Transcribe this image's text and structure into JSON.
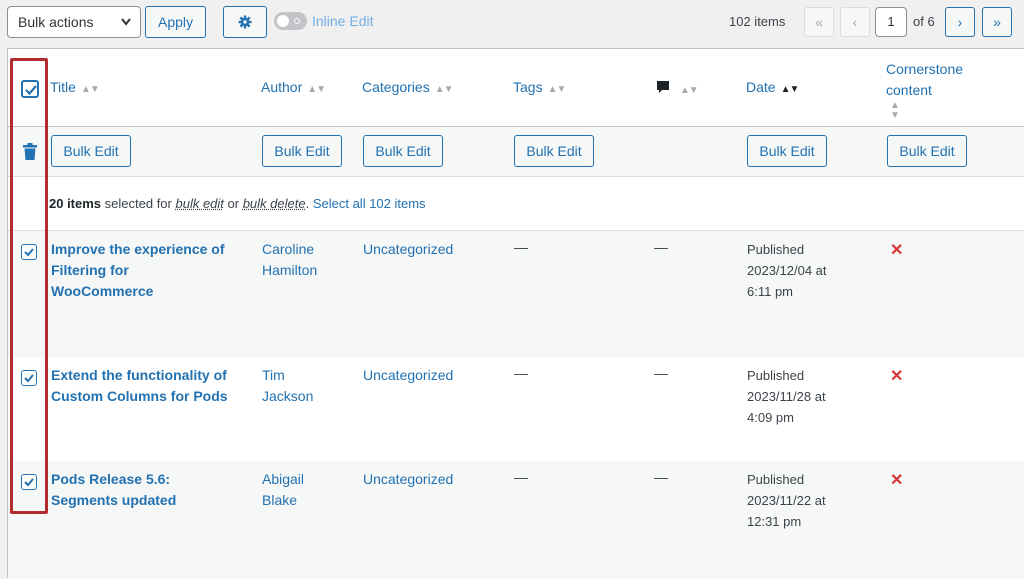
{
  "toolbar": {
    "bulk_actions": "Bulk actions",
    "apply": "Apply",
    "inline_edit": "Inline Edit",
    "items_count": "102 items",
    "first_page": "«",
    "prev_page": "‹",
    "current_page": "1",
    "of_pages": "of 6",
    "next_page": "›",
    "last_page": "»"
  },
  "columns": {
    "title": "Title",
    "author": "Author",
    "categories": "Categories",
    "tags": "Tags",
    "date": "Date",
    "cornerstone_line1": "Cornerstone",
    "cornerstone_line2": "content"
  },
  "bulk_edit_label": "Bulk Edit",
  "selection": {
    "count": "20 items",
    "selected_for": " selected for ",
    "bulk_edit": "bulk edit",
    "or": " or ",
    "bulk_delete": "bulk delete",
    "period": ". ",
    "select_all": "Select all 102 items"
  },
  "rows": [
    {
      "title_lines": [
        "Improve the experience of",
        "Filtering for",
        "WooCommerce"
      ],
      "author_lines": [
        "Caroline",
        "Hamilton"
      ],
      "category": "Uncategorized",
      "tags": "—",
      "comments": "—",
      "date_lines": [
        "Published",
        "2023/12/04 at",
        "6:11 pm"
      ],
      "cornerstone": "✕"
    },
    {
      "title_lines": [
        "Extend the functionality of",
        "Custom Columns for Pods"
      ],
      "author_lines": [
        "Tim",
        "Jackson"
      ],
      "category": "Uncategorized",
      "tags": "—",
      "comments": "—",
      "date_lines": [
        "Published",
        "2023/11/28 at",
        "4:09 pm"
      ],
      "cornerstone": "✕"
    },
    {
      "title_lines": [
        "Pods Release 5.6:",
        "Segments updated"
      ],
      "author_lines": [
        "Abigail",
        "Blake"
      ],
      "category": "Uncategorized",
      "tags": "—",
      "comments": "—",
      "date_lines": [
        "Published",
        "2023/11/22 at",
        "12:31 pm"
      ],
      "cornerstone": "✕"
    }
  ],
  "icons": {
    "gear": "gear-icon",
    "comment": "comment-bubble-icon",
    "trash": "trash-icon",
    "checkbox": "checkbox-checked-icon",
    "not_cornerstone": "x-icon"
  },
  "colors": {
    "link": "#2271b1",
    "highlight": "#b32d2e",
    "no": "#d63638"
  }
}
